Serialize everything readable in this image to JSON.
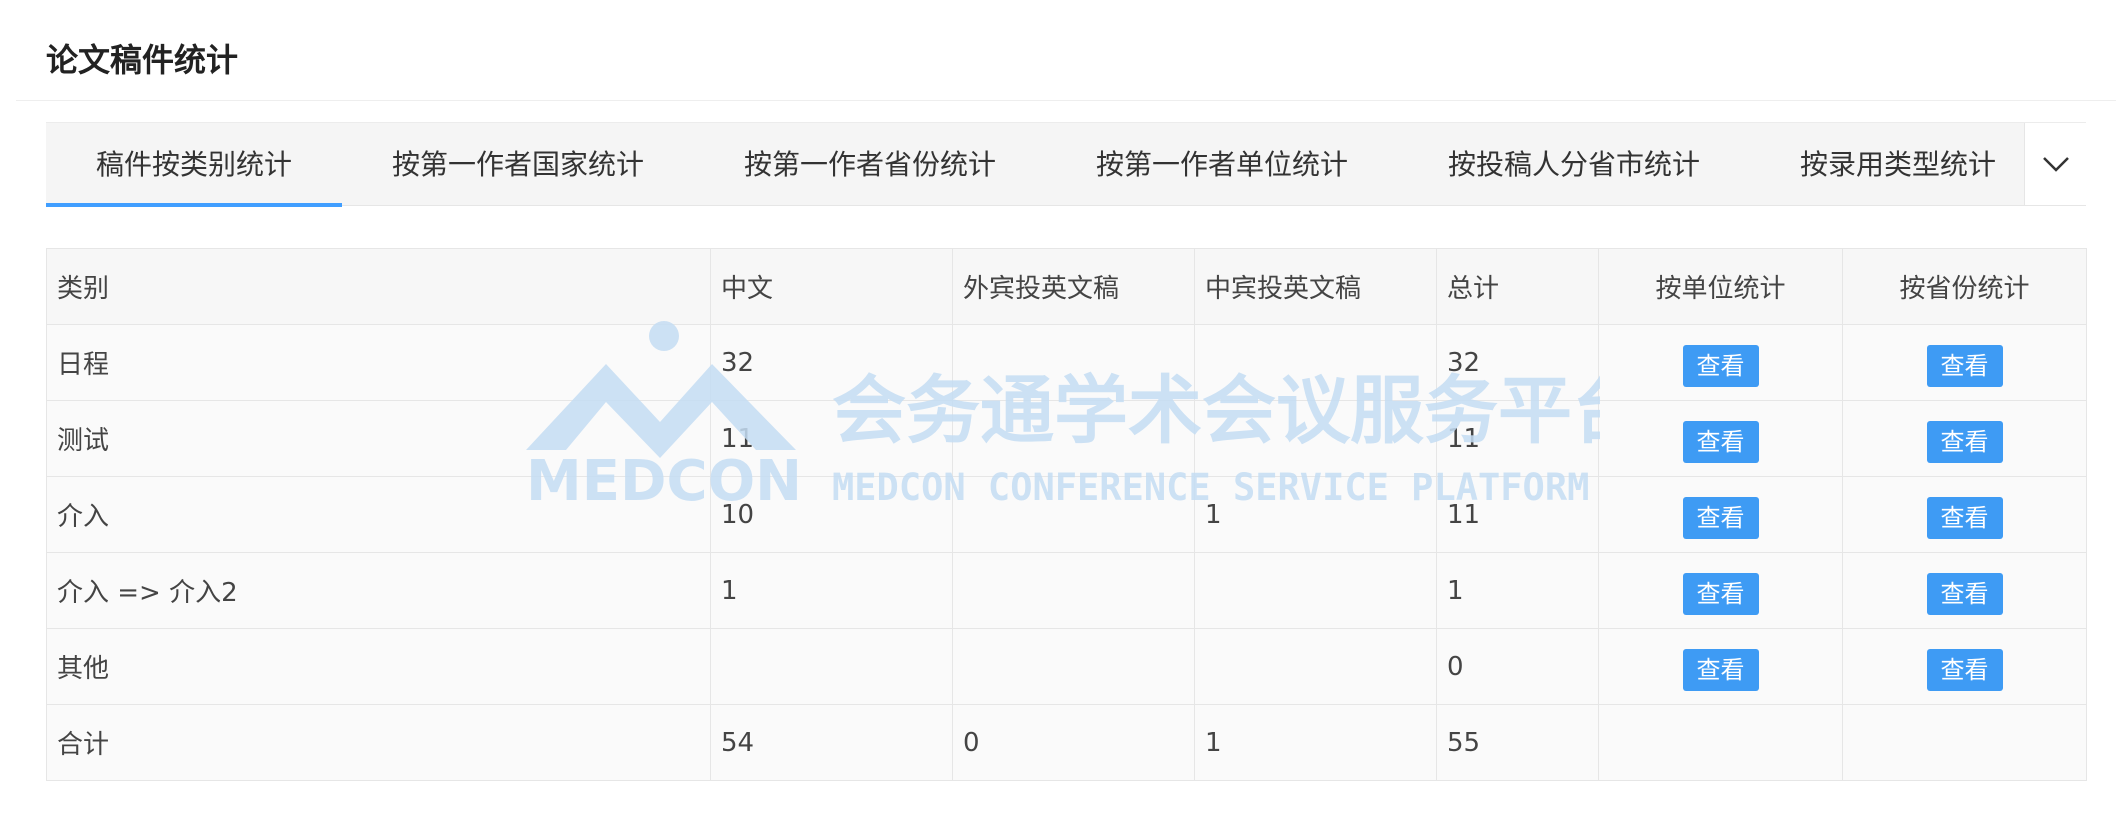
{
  "page": {
    "title": "论文稿件统计"
  },
  "tabs": [
    {
      "label": "稿件按类别统计",
      "active": true
    },
    {
      "label": "按第一作者国家统计"
    },
    {
      "label": "按第一作者省份统计"
    },
    {
      "label": "按第一作者单位统计"
    },
    {
      "label": "按投稿人分省市统计"
    },
    {
      "label": "按录用类型统计"
    }
  ],
  "tab_more_icon": "chevron-down-icon",
  "table": {
    "headers": [
      "类别",
      "中文",
      "外宾投英文稿",
      "中宾投英文稿",
      "总计",
      "按单位统计",
      "按省份统计"
    ],
    "rows": [
      {
        "category": "日程",
        "zh": "32",
        "foreign_en": "",
        "domestic_en": "",
        "total": "32",
        "by_unit": "查看",
        "by_province": "查看"
      },
      {
        "category": "测试",
        "zh": "11",
        "foreign_en": "",
        "domestic_en": "",
        "total": "11",
        "by_unit": "查看",
        "by_province": "查看"
      },
      {
        "category": "介入",
        "zh": "10",
        "foreign_en": "",
        "domestic_en": "1",
        "total": "11",
        "by_unit": "查看",
        "by_province": "查看"
      },
      {
        "category": "介入 => 介入2",
        "zh": "1",
        "foreign_en": "",
        "domestic_en": "",
        "total": "1",
        "by_unit": "查看",
        "by_province": "查看"
      },
      {
        "category": "其他",
        "zh": "",
        "foreign_en": "",
        "domestic_en": "",
        "total": "0",
        "by_unit": "查看",
        "by_province": "查看"
      }
    ],
    "summary": {
      "category": "合计",
      "zh": "54",
      "foreign_en": "0",
      "domestic_en": "1",
      "total": "55"
    }
  },
  "watermark": {
    "logo_text": "MEDCON",
    "cn_text": "会务通学术会议服务平台",
    "en_text": "MEDCON CONFERENCE SERVICE PLATFORM"
  },
  "colors": {
    "accent": "#409eff",
    "button": "#3e9bf4",
    "watermark": "#c5ddf3"
  }
}
